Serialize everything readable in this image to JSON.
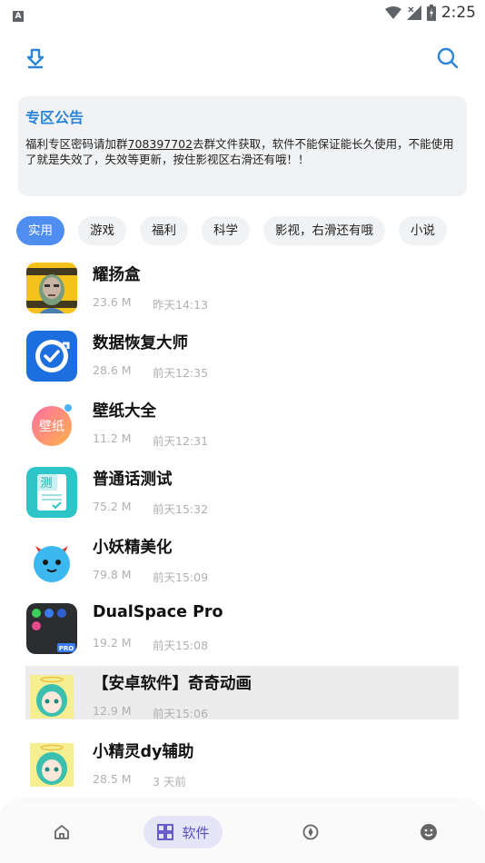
{
  "status_bar": {
    "indicator": "A",
    "time": "2:25",
    "icons": [
      "wifi-icon",
      "no-signal-icon",
      "battery-charging-icon"
    ]
  },
  "topbar": {
    "icons": [
      "download-icon",
      "search-icon"
    ],
    "accent": "#2a84d8"
  },
  "notice": {
    "title": "专区公告",
    "body_prefix": "福利专区密码请加群",
    "group_number": "708397702",
    "body_suffix": "去群文件获取，软件不能保证能长久使用，不能使用了就是失效了，失效等更新，按住影视区右滑还有哦！！"
  },
  "tabs": [
    {
      "label": "实用",
      "active": true
    },
    {
      "label": "游戏",
      "active": false
    },
    {
      "label": "福利",
      "active": false
    },
    {
      "label": "科学",
      "active": false
    },
    {
      "label": "影视，右滑还有哦",
      "active": false
    },
    {
      "label": "小说",
      "active": false
    }
  ],
  "apps": [
    {
      "name": "耀扬盒",
      "size": "23.6 M",
      "time": "昨天14:13",
      "icon": "meme-face-icon"
    },
    {
      "name": "数据恢复大师",
      "size": "28.6 M",
      "time": "前天12:35",
      "icon": "data-recovery-icon"
    },
    {
      "name": "壁纸大全",
      "size": "11.2 M",
      "time": "前天12:31",
      "icon_text": "壁纸",
      "icon": "wallpaper-icon"
    },
    {
      "name": "普通话测试",
      "size": "75.2 M",
      "time": "前天15:32",
      "icon_text": "测",
      "icon": "mandarin-test-icon"
    },
    {
      "name": "小妖精美化",
      "size": "79.8 M",
      "time": "前天15:09",
      "icon": "little-demon-icon"
    },
    {
      "name": "DualSpace Pro",
      "size": "19.2 M",
      "time": "前天15:08",
      "icon_text": "PRO",
      "icon": "dualspace-icon"
    },
    {
      "name": "【安卓软件】奇奇动画",
      "size": "12.9 M",
      "time": "前天15:06",
      "icon": "anime-girl-icon",
      "highlighted": true
    },
    {
      "name": "小精灵dy辅助",
      "size": "28.5 M",
      "time": "3 天前",
      "icon": "anime-girl-icon"
    }
  ],
  "bottom_nav": {
    "items": [
      {
        "icon": "home-icon"
      },
      {
        "icon": "grid-icon",
        "label": "软件",
        "active": true
      },
      {
        "icon": "compass-icon"
      },
      {
        "icon": "smiley-icon"
      }
    ],
    "active_color": "#5b4ec4"
  }
}
